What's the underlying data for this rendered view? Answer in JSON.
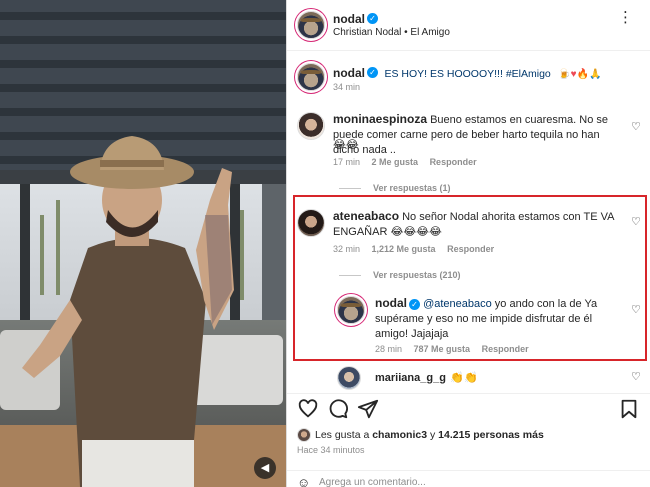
{
  "post": {
    "username": "nodal",
    "subtitle": "Christian Nodal • El Amigo",
    "more_icon": "more-dots-icon",
    "caption_text": "ES HOY! ES HOOOOY!!! #ElAmigo",
    "caption_time": "34 min"
  },
  "comments": [
    {
      "username": "moninaespinoza",
      "text": "Bueno estamos en cuaresma. No se puede comer carne pero de beber harto tequila no han dicho nada ..",
      "emojis": "😂😂",
      "time": "17 min",
      "likes": "2 Me gusta",
      "reply": "Responder",
      "view_replies": "Ver respuestas (1)"
    },
    {
      "username": "ateneabaco",
      "text": "No señor Nodal ahorita estamos con TE VA ENGAÑAR",
      "emojis": "😂😂😂😂",
      "time": "32 min",
      "likes": "1,212 Me gusta",
      "reply": "Responder",
      "view_replies": "Ver respuestas (210)"
    },
    {
      "username": "mariiana_g_g",
      "emojis": "👏👏"
    }
  ],
  "reply": {
    "username": "nodal",
    "mention": "@ateneabaco",
    "text": "yo ando con la de Ya supérame y eso no me impide disfrutar de él amigo! Jajajaja",
    "time": "28 min",
    "likes": "787 Me gusta",
    "reply_label": "Responder"
  },
  "likes": {
    "prefix": "Les gusta a",
    "first_user": "chamonic3",
    "connector": "y",
    "count": "14.215 personas más",
    "time": "Hace 34 minutos"
  },
  "add_comment": {
    "placeholder": "Agrega un comentario..."
  },
  "colors": {
    "highlight": "#d7252a",
    "verified": "#0095f6",
    "link": "#00376b"
  }
}
